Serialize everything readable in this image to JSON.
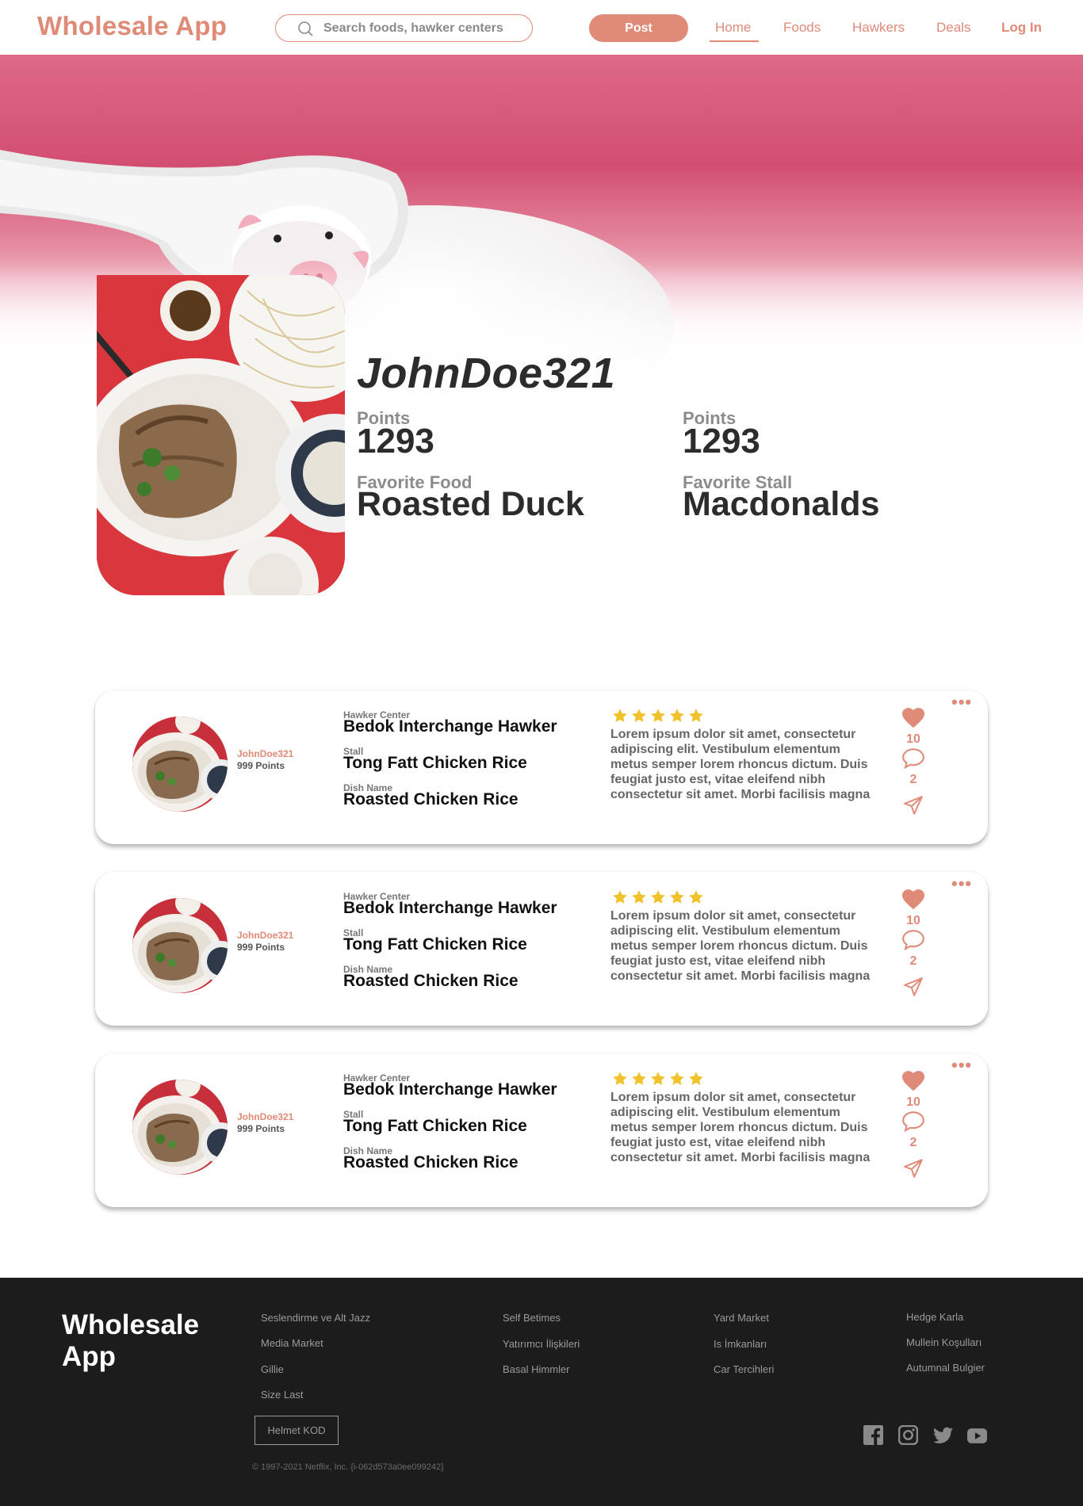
{
  "header": {
    "logo": "Wholesale App",
    "search_placeholder": "Search foods, hawker centers",
    "post_label": "Post",
    "nav": [
      "Home",
      "Foods",
      "Hawkers",
      "Deals"
    ],
    "login_label": "Log In",
    "accent_color": "#e08a78"
  },
  "profile": {
    "username": "JohnDoe321",
    "points_label_1": "Points",
    "points_value_1": "1293",
    "points_label_2": "Points",
    "points_value_2": "1293",
    "favorite_food_label": "Favorite Food",
    "favorite_food": "Roasted Duck",
    "favorite_stall_label": "Favorite Stall",
    "favorite_stall": "Macdonalds"
  },
  "reviews": [
    {
      "user": "JohnDoe321",
      "points": "999 Points",
      "hawker_center_label": "Hawker Center",
      "hawker_center": "Bedok Interchange Hawker",
      "stall_label": "Stall",
      "stall": "Tong Fatt Chicken Rice",
      "dish_label": "Dish Name",
      "dish": "Roasted Chicken Rice",
      "rating": 5,
      "text": "Lorem ipsum dolor sit amet, consectetur adipiscing elit. Vestibulum elementum metus semper lorem rhoncus dictum. Duis feugiat justo est, vitae eleifend nibh consectetur sit amet. Morbi facilisis magna",
      "likes": "10",
      "comments": "2"
    },
    {
      "user": "JohnDoe321",
      "points": "999 Points",
      "hawker_center_label": "Hawker Center",
      "hawker_center": "Bedok Interchange Hawker",
      "stall_label": "Stall",
      "stall": "Tong Fatt Chicken Rice",
      "dish_label": "Dish Name",
      "dish": "Roasted Chicken Rice",
      "rating": 5,
      "text": "Lorem ipsum dolor sit amet, consectetur adipiscing elit. Vestibulum elementum metus semper lorem rhoncus dictum. Duis feugiat justo est, vitae eleifend nibh consectetur sit amet. Morbi facilisis magna",
      "likes": "10",
      "comments": "2"
    },
    {
      "user": "JohnDoe321",
      "points": "999 Points",
      "hawker_center_label": "Hawker Center",
      "hawker_center": "Bedok Interchange Hawker",
      "stall_label": "Stall",
      "stall": "Tong Fatt Chicken Rice",
      "dish_label": "Dish Name",
      "dish": "Roasted Chicken Rice",
      "rating": 5,
      "text": "Lorem ipsum dolor sit amet, consectetur adipiscing elit. Vestibulum elementum metus semper lorem rhoncus dictum. Duis feugiat justo est, vitae eleifend nibh consectetur sit amet. Morbi facilisis magna",
      "likes": "10",
      "comments": "2"
    }
  ],
  "footer": {
    "logo": "Wholesale App",
    "col1": [
      "Seslendirme ve Alt Jazz",
      "Media Market",
      "Gillie",
      "Size Last"
    ],
    "col2": [
      "Self Betimes",
      "Yatırımcı İlişkileri",
      "Basal Himmler"
    ],
    "col3": [
      "Yard Market",
      "Is İmkanları",
      "Car Tercihleri"
    ],
    "col4": [
      "Hedge Karla",
      "Mullein Koşulları",
      "Autumnal Bulgier"
    ],
    "button_label": "Helmet KOD",
    "copyright": "© 1997-2021 Netflix, Inc.  {i-062d573a0ee099242}",
    "social_icons": [
      "facebook-icon",
      "instagram-icon",
      "twitter-icon",
      "youtube-icon"
    ]
  },
  "colors": {
    "accent": "#e08a78",
    "star": "#f0c22c",
    "footer_bg": "#1c1c1c"
  }
}
